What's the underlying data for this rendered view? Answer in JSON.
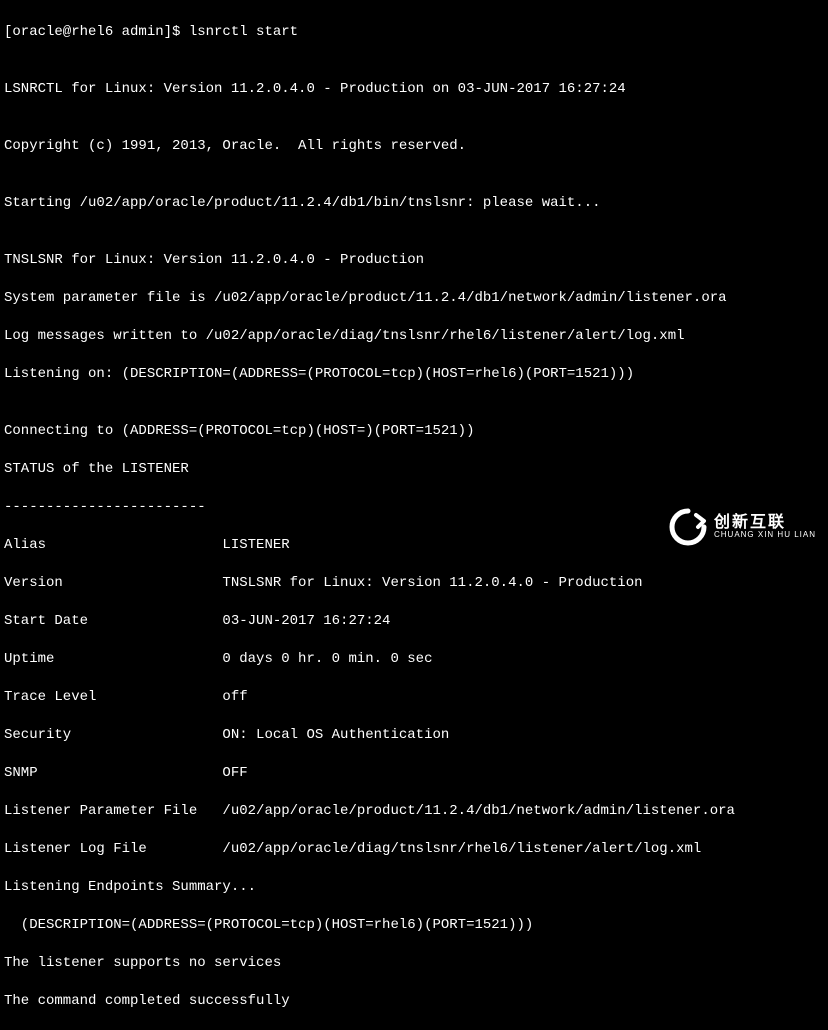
{
  "terminal": {
    "lines": [
      "[oracle@rhel6 admin]$ lsnrctl start",
      "",
      "LSNRCTL for Linux: Version 11.2.0.4.0 - Production on 03-JUN-2017 16:27:24",
      "",
      "Copyright (c) 1991, 2013, Oracle.  All rights reserved.",
      "",
      "Starting /u02/app/oracle/product/11.2.4/db1/bin/tnslsnr: please wait...",
      "",
      "TNSLSNR for Linux: Version 11.2.0.4.0 - Production",
      "System parameter file is /u02/app/oracle/product/11.2.4/db1/network/admin/listener.ora",
      "Log messages written to /u02/app/oracle/diag/tnslsnr/rhel6/listener/alert/log.xml",
      "Listening on: (DESCRIPTION=(ADDRESS=(PROTOCOL=tcp)(HOST=rhel6)(PORT=1521)))",
      "",
      "Connecting to (ADDRESS=(PROTOCOL=tcp)(HOST=)(PORT=1521))",
      "STATUS of the LISTENER",
      "------------------------",
      "Alias                     LISTENER",
      "Version                   TNSLSNR for Linux: Version 11.2.0.4.0 - Production",
      "Start Date                03-JUN-2017 16:27:24",
      "Uptime                    0 days 0 hr. 0 min. 0 sec",
      "Trace Level               off",
      "Security                  ON: Local OS Authentication",
      "SNMP                      OFF",
      "Listener Parameter File   /u02/app/oracle/product/11.2.4/db1/network/admin/listener.ora",
      "Listener Log File         /u02/app/oracle/diag/tnslsnr/rhel6/listener/alert/log.xml",
      "Listening Endpoints Summary...",
      "  (DESCRIPTION=(ADDRESS=(PROTOCOL=tcp)(HOST=rhel6)(PORT=1521)))",
      "The listener supports no services",
      "The command completed successfully"
    ]
  },
  "watermark": {
    "cn": "创新互联",
    "py": "CHUANG XIN HU LIAN"
  }
}
